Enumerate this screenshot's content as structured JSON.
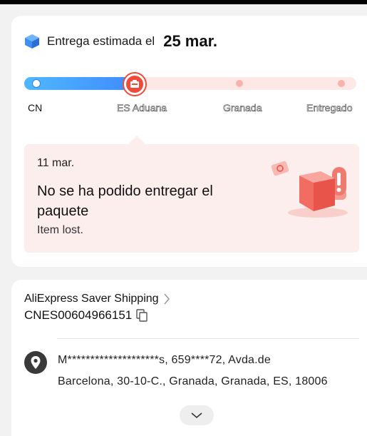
{
  "delivery": {
    "estimate_label": "Entrega estimada el",
    "estimate_date": "25 mar."
  },
  "progress": {
    "steps": [
      "CN",
      "ES Aduana",
      "Granada",
      "Entregado"
    ],
    "current_step_index": 1,
    "colors": {
      "done": "#3f8bff",
      "current": "#f04a3a",
      "pending": "#f7b3ab",
      "track": "#fde8e6"
    }
  },
  "notice": {
    "date": "11 mar.",
    "title": "No se ha podido entregar el paquete",
    "description": "Item lost."
  },
  "shipping": {
    "method": "AliExpress Saver Shipping",
    "tracking_number": "CNES00604966151"
  },
  "address": {
    "line1": "M********************s, 659****72, Avda.de",
    "line2": "Barcelona, 30-10-C., Granada, Granada, ES, 18006"
  },
  "icons": {
    "box": "box-icon",
    "pin": "location-pin-icon",
    "copy": "copy-icon",
    "expand": "chevron-down-icon"
  }
}
